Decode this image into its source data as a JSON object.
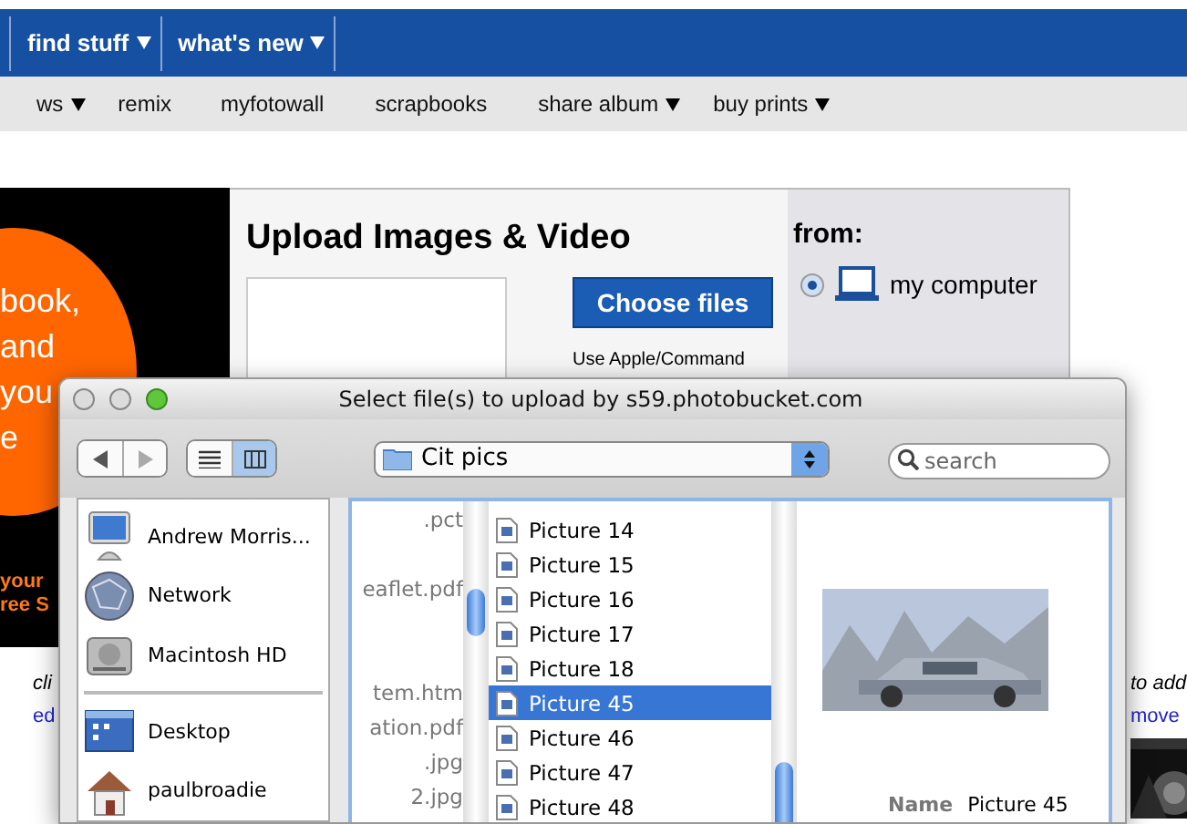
{
  "nav": {
    "items": [
      {
        "label": "find stuff",
        "dropdown": true
      },
      {
        "label": "what's new",
        "dropdown": true
      }
    ]
  },
  "subnav": {
    "items": [
      {
        "label": "ws",
        "dropdown": true
      },
      {
        "label": "remix",
        "dropdown": false
      },
      {
        "label": "myfotowall",
        "dropdown": false
      },
      {
        "label": "scrapbooks",
        "dropdown": false
      },
      {
        "label": "share album",
        "dropdown": true
      },
      {
        "label": "buy prints",
        "dropdown": true
      }
    ]
  },
  "promo": {
    "headline_lines": [
      "book,",
      "and",
      "you",
      "e"
    ],
    "footer_lines": [
      "your",
      "ree S"
    ]
  },
  "upload": {
    "title": "Upload Images & Video",
    "button": "Choose files",
    "hint": "Use Apple/Command"
  },
  "source": {
    "heading": "from:",
    "options": [
      {
        "label": "my computer",
        "selected": true
      }
    ]
  },
  "below": {
    "left_caption": "cli",
    "left_link": "ed",
    "right_caption": "to add",
    "right_link": "move"
  },
  "dialog": {
    "title": "Select file(s) to upload by s59.photobucket.com",
    "folder": "Cit pics",
    "search": {
      "placeholder": "search"
    },
    "view_modes": [
      {
        "kind": "list",
        "selected": false
      },
      {
        "kind": "columns",
        "selected": true
      }
    ],
    "devices": [
      {
        "label": "Andrew Morris...",
        "kind": "computer"
      },
      {
        "label": "Network",
        "kind": "network"
      },
      {
        "label": "Macintosh HD",
        "kind": "disk"
      }
    ],
    "places": [
      {
        "label": "Desktop",
        "kind": "desktop"
      },
      {
        "label": "paulbroadie",
        "kind": "home"
      }
    ],
    "column_1": [
      {
        "kind": "file",
        "name": ".pct"
      },
      {
        "kind": "hidden"
      },
      {
        "kind": "file",
        "name": "eaflet.pdf"
      },
      {
        "kind": "hidden"
      },
      {
        "kind": "hidden"
      },
      {
        "kind": "file",
        "name": "tem.htm"
      },
      {
        "kind": "file",
        "name": "ation.pdf"
      },
      {
        "kind": "file",
        "name": ".jpg"
      },
      {
        "kind": "file",
        "name": "2.jpg"
      }
    ],
    "column_2": [
      {
        "name": "Picture 14",
        "selected": false
      },
      {
        "name": "Picture 15",
        "selected": false
      },
      {
        "name": "Picture 16",
        "selected": false
      },
      {
        "name": "Picture 17",
        "selected": false
      },
      {
        "name": "Picture 18",
        "selected": false
      },
      {
        "name": "Picture 45",
        "selected": true
      },
      {
        "name": "Picture 46",
        "selected": false
      },
      {
        "name": "Picture 47",
        "selected": false
      },
      {
        "name": "Picture 48",
        "selected": false
      }
    ],
    "preview": {
      "name_label": "Name",
      "name_value": "Picture 45"
    }
  }
}
